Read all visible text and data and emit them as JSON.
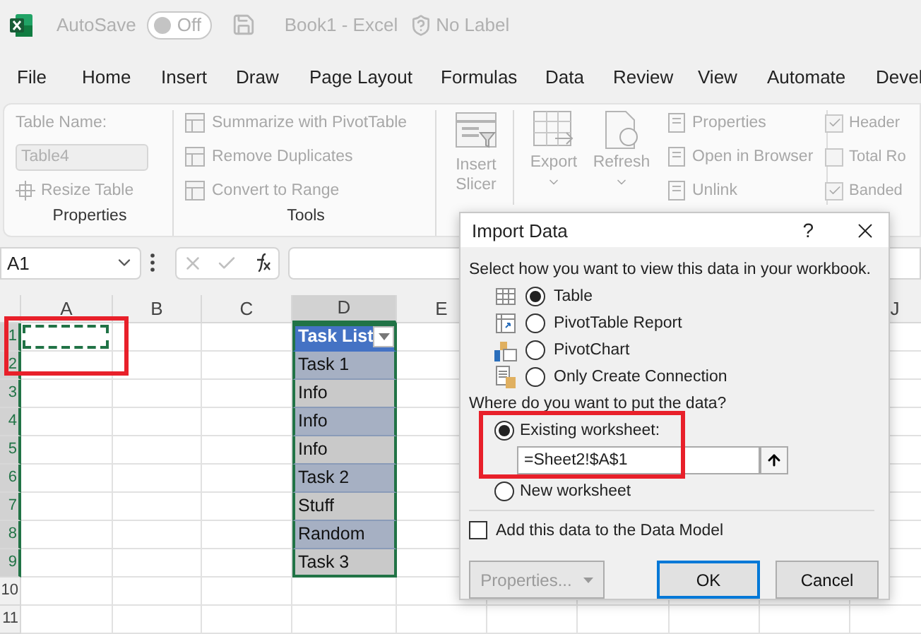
{
  "title_bar": {
    "autosave_label": "AutoSave",
    "autosave": {
      "label": "Off",
      "on": false
    },
    "document": "Book1  -  Excel",
    "sensitivity": "No Label"
  },
  "menu": [
    "File",
    "Home",
    "Insert",
    "Draw",
    "Page Layout",
    "Formulas",
    "Data",
    "Review",
    "View",
    "Automate",
    "Devel"
  ],
  "ribbon": {
    "disabled": true,
    "properties_group": {
      "name_label": "Table Name:",
      "name_value": "Table4",
      "resize": "Resize Table",
      "label": "Properties"
    },
    "tools_group": {
      "items": [
        "Summarize with PivotTable",
        "Remove Duplicates",
        "Convert to Range"
      ],
      "label": "Tools"
    },
    "slicer": "Insert Slicer",
    "external": {
      "export": "Export",
      "refresh": "Refresh",
      "items": [
        "Properties",
        "Open in Browser",
        "Unlink"
      ]
    },
    "style_options": [
      {
        "label": "Header",
        "checked": true
      },
      {
        "label": "Total Ro",
        "checked": false
      },
      {
        "label": "Banded",
        "checked": true
      }
    ]
  },
  "formula_bar": {
    "name_box": "A1"
  },
  "sheet": {
    "columns": [
      {
        "label": "A",
        "selected": false
      },
      {
        "label": "B",
        "selected": false
      },
      {
        "label": "C",
        "selected": false
      },
      {
        "label": "D",
        "selected": true
      },
      {
        "label": "E",
        "selected": false
      },
      {
        "label": "J",
        "selected": false
      }
    ],
    "rows": [
      {
        "label": "1",
        "selected": true
      },
      {
        "label": "2",
        "selected": true
      },
      {
        "label": "3",
        "selected": true
      },
      {
        "label": "4",
        "selected": true
      },
      {
        "label": "5",
        "selected": true
      },
      {
        "label": "6",
        "selected": true
      },
      {
        "label": "7",
        "selected": true
      },
      {
        "label": "8",
        "selected": true
      },
      {
        "label": "9",
        "selected": true
      },
      {
        "label": "10",
        "selected": false
      },
      {
        "label": "11",
        "selected": false
      }
    ],
    "table": {
      "header": "Task List",
      "rows": [
        "Task 1",
        "Info",
        "Info",
        "Info",
        "Task 2",
        "Stuff",
        "Random",
        "Task 3"
      ]
    }
  },
  "dialog": {
    "title": "Import Data",
    "help": "?",
    "prompt": "Select how you want to view this data in your workbook.",
    "view_options": [
      {
        "label": "Table",
        "selected": true,
        "kind": "table"
      },
      {
        "label": "PivotTable Report",
        "selected": false,
        "kind": "pivottable"
      },
      {
        "label": "PivotChart",
        "selected": false,
        "kind": "pivotchart"
      },
      {
        "label": "Only Create Connection",
        "selected": false,
        "kind": "connection"
      }
    ],
    "location_prompt": "Where do you want to put the data?",
    "location_options": [
      {
        "label": "Existing worksheet:",
        "selected": true
      },
      {
        "label": "New worksheet",
        "selected": false
      }
    ],
    "reference": "=Sheet2!$A$1",
    "data_model": {
      "label": "Add this data to the Data Model",
      "checked": false
    },
    "buttons": [
      {
        "label": "Properties...",
        "kind": "dropdown",
        "disabled": true
      },
      {
        "label": "OK",
        "kind": "default",
        "disabled": false
      },
      {
        "label": "Cancel",
        "kind": "normal",
        "disabled": false
      }
    ]
  }
}
